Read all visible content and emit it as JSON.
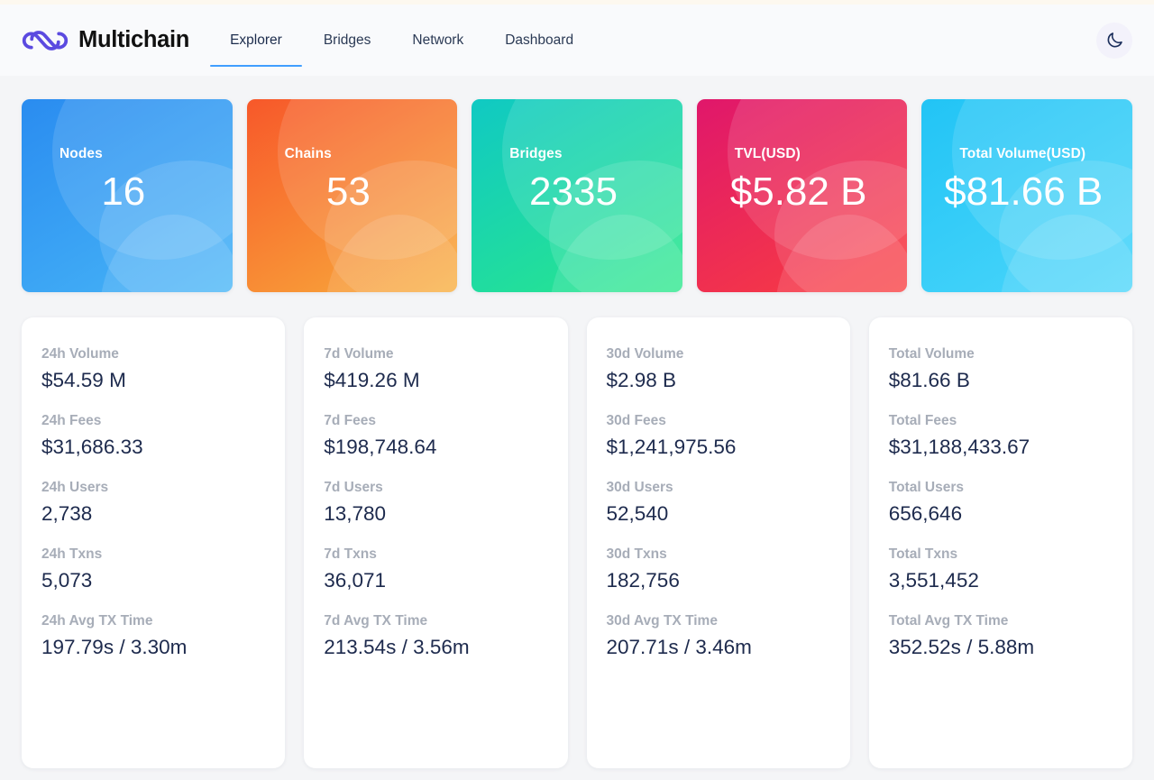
{
  "header": {
    "brand_name": "Multichain",
    "logo_icon": "multichain-infinity-logo",
    "nav": [
      {
        "label": "Explorer",
        "active": true
      },
      {
        "label": "Bridges",
        "active": false
      },
      {
        "label": "Network",
        "active": false
      },
      {
        "label": "Dashboard",
        "active": false
      }
    ],
    "theme_toggle_icon": "moon-icon",
    "accent_color": "#409eff",
    "brand_color": "#5b4ae0"
  },
  "hero_cards": [
    {
      "label": "Nodes",
      "value": "16",
      "color_from": "#2a8cf0",
      "color_to": "#47b5f7"
    },
    {
      "label": "Chains",
      "value": "53",
      "color_from": "#f7582a",
      "color_to": "#f9ae3c"
    },
    {
      "label": "Bridges",
      "value": "2335",
      "color_from": "#10c9c3",
      "color_to": "#2ae88a"
    },
    {
      "label": "TVL(USD)",
      "value": "$5.82 B",
      "color_from": "#e0176b",
      "color_to": "#fa3f3f"
    },
    {
      "label": "Total Volume(USD)",
      "value": "$81.66 B",
      "color_from": "#22c4f5",
      "color_to": "#4bd6fb"
    }
  ],
  "panels": [
    {
      "metrics": [
        {
          "label": "24h Volume",
          "value": "$54.59 M"
        },
        {
          "label": "24h Fees",
          "value": "$31,686.33"
        },
        {
          "label": "24h Users",
          "value": "2,738"
        },
        {
          "label": "24h Txns",
          "value": "5,073"
        },
        {
          "label": "24h Avg TX Time",
          "value": "197.79s / 3.30m"
        }
      ]
    },
    {
      "metrics": [
        {
          "label": "7d Volume",
          "value": "$419.26 M"
        },
        {
          "label": "7d Fees",
          "value": "$198,748.64"
        },
        {
          "label": "7d Users",
          "value": "13,780"
        },
        {
          "label": "7d Txns",
          "value": "36,071"
        },
        {
          "label": "7d Avg TX Time",
          "value": "213.54s / 3.56m"
        }
      ]
    },
    {
      "metrics": [
        {
          "label": "30d Volume",
          "value": "$2.98 B"
        },
        {
          "label": "30d Fees",
          "value": "$1,241,975.56"
        },
        {
          "label": "30d Users",
          "value": "52,540"
        },
        {
          "label": "30d Txns",
          "value": "182,756"
        },
        {
          "label": "30d Avg TX Time",
          "value": "207.71s / 3.46m"
        }
      ]
    },
    {
      "metrics": [
        {
          "label": "Total Volume",
          "value": "$81.66 B"
        },
        {
          "label": "Total Fees",
          "value": "$31,188,433.67"
        },
        {
          "label": "Total Users",
          "value": "656,646"
        },
        {
          "label": "Total Txns",
          "value": "3,551,452"
        },
        {
          "label": "Total Avg TX Time",
          "value": "352.52s / 5.88m"
        }
      ]
    }
  ]
}
